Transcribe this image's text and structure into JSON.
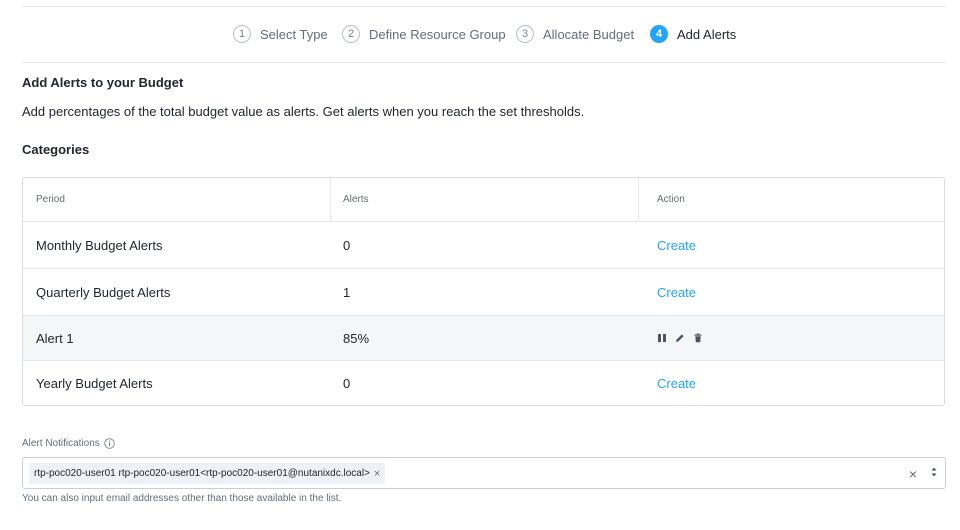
{
  "wizard": {
    "steps": [
      {
        "num": "1",
        "label": "Select Type"
      },
      {
        "num": "2",
        "label": "Define Resource Group"
      },
      {
        "num": "3",
        "label": "Allocate Budget"
      },
      {
        "num": "4",
        "label": "Add Alerts"
      }
    ],
    "active_step": 4
  },
  "page": {
    "title": "Add Alerts to your Budget",
    "description": "Add percentages of the total budget value as alerts. Get alerts when you reach the set thresholds.",
    "section_title": "Categories"
  },
  "table": {
    "headers": [
      "Period",
      "Alerts",
      "Action"
    ],
    "rows": [
      {
        "period": "Monthly Budget Alerts",
        "alerts": "0",
        "action": "Create"
      },
      {
        "period": "Quarterly Budget Alerts",
        "alerts": "1",
        "action": "Create"
      },
      {
        "period": "Alert 1",
        "alerts": "85%",
        "action_icons": [
          "pause-icon",
          "pencil-icon",
          "trash-icon"
        ]
      },
      {
        "period": "Yearly Budget Alerts",
        "alerts": "0",
        "action": "Create"
      }
    ]
  },
  "notifications": {
    "label": "Alert Notifications",
    "selected_tag": "rtp-poc020-user01 rtp-poc020-user01<rtp-poc020-user01@nutanixdc.local>",
    "help_text": "You can also input email addresses other than those available in the list."
  },
  "colors": {
    "accent": "#22a5f7",
    "text": "#22272e",
    "muted": "#626d7a",
    "border": "#d9dde3",
    "highlight_row": "#f4f6f8"
  }
}
